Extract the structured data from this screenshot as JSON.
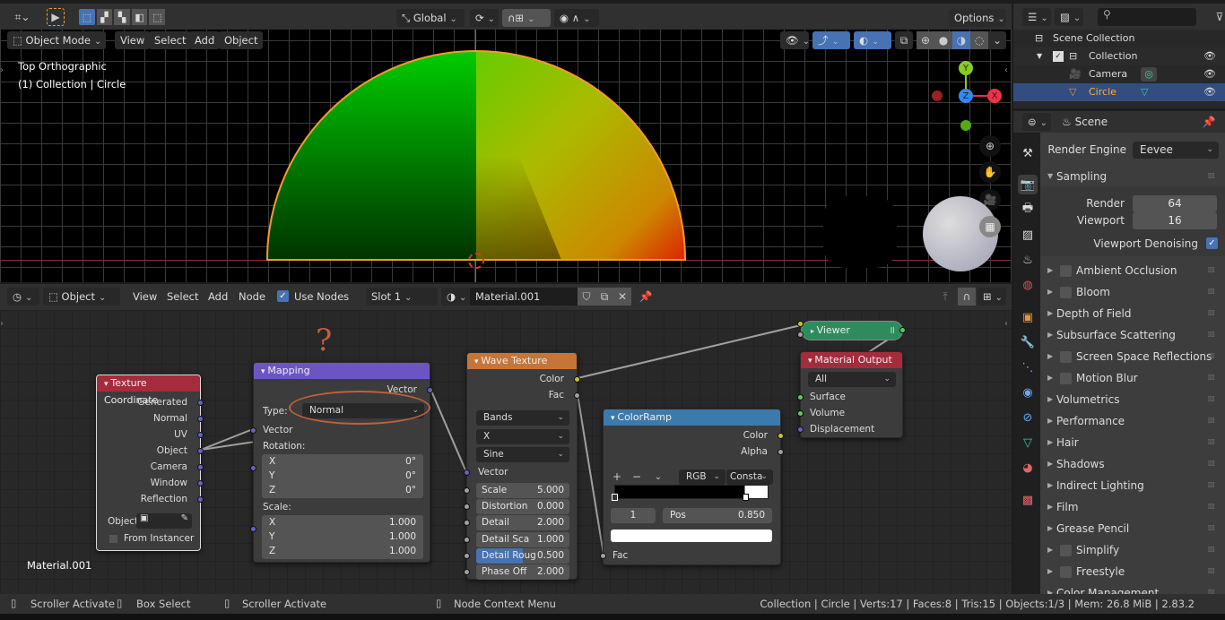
{
  "colors": {
    "accent": "#4772b3",
    "selected_row": "#334d80",
    "active_text": "#ffaf29"
  },
  "topbar": {
    "transform_orientation": "Global",
    "options_label": "Options",
    "select_mode_icons": [
      "select-box-new-icon",
      "select-extend-icon",
      "select-subtract-icon",
      "select-invert-icon",
      "select-intersect-icon"
    ]
  },
  "viewport": {
    "mode": "Object Mode",
    "menus": [
      "View",
      "Select",
      "Add",
      "Object"
    ],
    "view_name": "Top Orthographic",
    "object_info": "(1) Collection | Circle",
    "gizmo": {
      "y": "Y",
      "z": "Z",
      "x": "X"
    }
  },
  "outliner": {
    "root": "Scene Collection",
    "items": [
      {
        "name": "Collection",
        "type": "collection"
      },
      {
        "name": "Camera",
        "type": "camera"
      },
      {
        "name": "Circle",
        "type": "mesh",
        "selected": true
      }
    ]
  },
  "properties": {
    "context": "Scene",
    "render_engine_label": "Render Engine",
    "render_engine": "Eevee",
    "sampling": {
      "title": "Sampling",
      "render_label": "Render",
      "render": "64",
      "viewport_label": "Viewport",
      "viewport": "16",
      "denoise_label": "Viewport Denoising",
      "denoise": true
    },
    "panels": [
      {
        "label": "Ambient Occlusion",
        "checkbox": true
      },
      {
        "label": "Bloom",
        "checkbox": true
      },
      {
        "label": "Depth of Field",
        "checkbox": false
      },
      {
        "label": "Subsurface Scattering",
        "checkbox": false
      },
      {
        "label": "Screen Space Reflections",
        "checkbox": true
      },
      {
        "label": "Motion Blur",
        "checkbox": true
      },
      {
        "label": "Volumetrics",
        "checkbox": false
      },
      {
        "label": "Performance",
        "checkbox": false
      },
      {
        "label": "Hair",
        "checkbox": false
      },
      {
        "label": "Shadows",
        "checkbox": false
      },
      {
        "label": "Indirect Lighting",
        "checkbox": false
      },
      {
        "label": "Film",
        "checkbox": false
      },
      {
        "label": "Grease Pencil",
        "checkbox": false
      },
      {
        "label": "Simplify",
        "checkbox": true
      },
      {
        "label": "Freestyle",
        "checkbox": true
      },
      {
        "label": "Color Management",
        "checkbox": false
      }
    ]
  },
  "node_editor": {
    "type": "Object",
    "menus": [
      "View",
      "Select",
      "Add",
      "Node"
    ],
    "use_nodes_label": "Use Nodes",
    "slot": "Slot 1",
    "material": "Material.001",
    "footer_material": "Material.001",
    "annotation": "?",
    "nodes": {
      "texcoord": {
        "title": "Texture Coordinate",
        "outputs": [
          "Generated",
          "Normal",
          "UV",
          "Object",
          "Camera",
          "Window",
          "Reflection"
        ],
        "object_label": "Object",
        "from_instancer": "From Instancer"
      },
      "mapping": {
        "title": "Mapping",
        "out": "Vector",
        "type_label": "Type:",
        "type": "Normal",
        "vector": "Vector",
        "rotation_label": "Rotation:",
        "rotation": [
          [
            "X",
            "0°"
          ],
          [
            "Y",
            "0°"
          ],
          [
            "Z",
            "0°"
          ]
        ],
        "scale_label": "Scale:",
        "scale": [
          [
            "X",
            "1.000"
          ],
          [
            "Y",
            "1.000"
          ],
          [
            "Z",
            "1.000"
          ]
        ]
      },
      "wave": {
        "title": "Wave Texture",
        "outputs": [
          "Color",
          "Fac"
        ],
        "wave_type": "Bands",
        "direction": "X",
        "profile": "Sine",
        "vector": "Vector",
        "fields": [
          [
            "Scale",
            "5.000"
          ],
          [
            "Distortion",
            "0.000"
          ],
          [
            "Detail",
            "2.000"
          ],
          [
            "Detail Sca",
            "1.000"
          ],
          [
            "Detail Roug",
            "0.500"
          ],
          [
            "Phase Off",
            "2.000"
          ]
        ]
      },
      "colorramp": {
        "title": "ColorRamp",
        "outputs": [
          "Color",
          "Alpha"
        ],
        "color_mode": "RGB",
        "interpolation": "Consta",
        "index": "1",
        "pos_label": "Pos",
        "pos": "0.850",
        "input": "Fac"
      },
      "viewer": {
        "title": "Viewer"
      },
      "output": {
        "title": "Material Output",
        "target": "All",
        "inputs": [
          "Surface",
          "Volume",
          "Displacement"
        ]
      }
    }
  },
  "status": {
    "left": [
      {
        "icon": "mouse-left-icon",
        "label": "Scroller Activate"
      },
      {
        "icon": "mouse-drag-icon",
        "label": "Box Select"
      },
      {
        "icon": "mouse-middle-icon",
        "label": "Scroller Activate"
      },
      {
        "icon": "mouse-right-icon",
        "label": "Node Context Menu"
      }
    ],
    "right": "Collection | Circle | Verts:17 | Faces:8 | Tris:15 | Objects:1/3 | Mem: 26.8 MiB | 2.83.2"
  }
}
